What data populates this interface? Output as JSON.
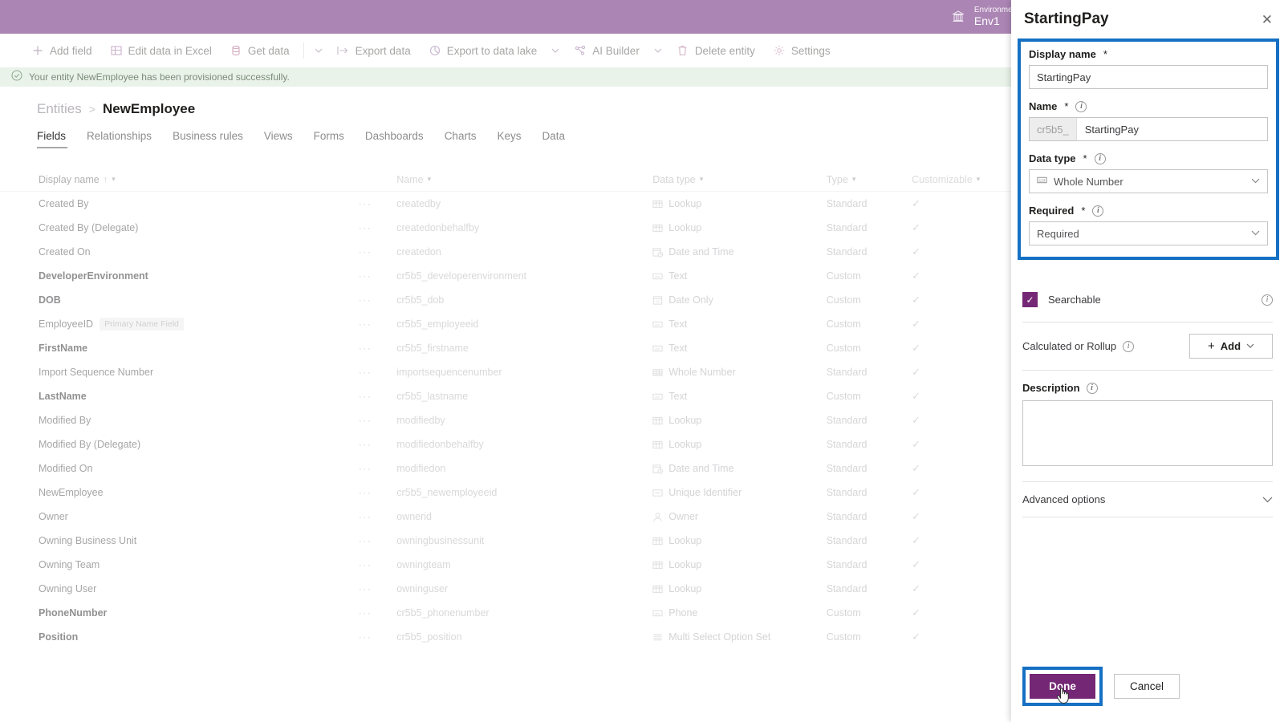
{
  "topbar": {
    "env_label": "Environment",
    "env_value": "Env1",
    "env_icon": "environment-icon"
  },
  "commandbar": {
    "items": [
      {
        "label": "Add field",
        "icon": "plus-icon"
      },
      {
        "label": "Edit data in Excel",
        "icon": "excel-icon"
      },
      {
        "label": "Get data",
        "icon": "database-icon"
      },
      {
        "label": "Export data",
        "icon": "export-icon"
      },
      {
        "label": "Export to data lake",
        "icon": "data-lake-icon"
      },
      {
        "label": "AI Builder",
        "icon": "ai-builder-icon"
      },
      {
        "label": "Delete entity",
        "icon": "trash-icon"
      },
      {
        "label": "Settings",
        "icon": "gear-icon"
      }
    ]
  },
  "notification": {
    "icon": "success-check-icon",
    "message": "Your entity NewEmployee has been provisioned successfully."
  },
  "breadcrumb": {
    "parent": "Entities",
    "separator": ">",
    "current": "NewEmployee"
  },
  "tabs": [
    {
      "label": "Fields",
      "active": true
    },
    {
      "label": "Relationships",
      "active": false
    },
    {
      "label": "Business rules",
      "active": false
    },
    {
      "label": "Views",
      "active": false
    },
    {
      "label": "Forms",
      "active": false
    },
    {
      "label": "Dashboards",
      "active": false
    },
    {
      "label": "Charts",
      "active": false
    },
    {
      "label": "Keys",
      "active": false
    },
    {
      "label": "Data",
      "active": false
    }
  ],
  "table": {
    "columns": [
      {
        "label": "Display name",
        "sorted": "ascending",
        "sort_glyph": "↑"
      },
      {
        "label": "Name"
      },
      {
        "label": "Data type"
      },
      {
        "label": "Type"
      },
      {
        "label": "Customizable"
      }
    ],
    "rows": [
      {
        "display": "Created By",
        "bold": false,
        "badge": "",
        "name": "createdby",
        "datatype": "Lookup",
        "dticon": "lookup-icon",
        "type": "Standard",
        "customizable": "✓"
      },
      {
        "display": "Created By (Delegate)",
        "bold": false,
        "badge": "",
        "name": "createdonbehalfby",
        "datatype": "Lookup",
        "dticon": "lookup-icon",
        "type": "Standard",
        "customizable": "✓"
      },
      {
        "display": "Created On",
        "bold": false,
        "badge": "",
        "name": "createdon",
        "datatype": "Date and Time",
        "dticon": "date-time-icon",
        "type": "Standard",
        "customizable": "✓"
      },
      {
        "display": "DeveloperEnvironment",
        "bold": true,
        "badge": "",
        "name": "cr5b5_developerenvironment",
        "datatype": "Text",
        "dticon": "text-icon",
        "type": "Custom",
        "customizable": "✓"
      },
      {
        "display": "DOB",
        "bold": true,
        "badge": "",
        "name": "cr5b5_dob",
        "datatype": "Date Only",
        "dticon": "date-only-icon",
        "type": "Custom",
        "customizable": "✓"
      },
      {
        "display": "EmployeeID",
        "bold": false,
        "badge": "Primary Name Field",
        "name": "cr5b5_employeeid",
        "datatype": "Text",
        "dticon": "text-icon",
        "type": "Custom",
        "customizable": "✓"
      },
      {
        "display": "FirstName",
        "bold": true,
        "badge": "",
        "name": "cr5b5_firstname",
        "datatype": "Text",
        "dticon": "text-icon",
        "type": "Custom",
        "customizable": "✓"
      },
      {
        "display": "Import Sequence Number",
        "bold": false,
        "badge": "",
        "name": "importsequencenumber",
        "datatype": "Whole Number",
        "dticon": "whole-number-icon",
        "type": "Standard",
        "customizable": "✓"
      },
      {
        "display": "LastName",
        "bold": true,
        "badge": "",
        "name": "cr5b5_lastname",
        "datatype": "Text",
        "dticon": "text-icon",
        "type": "Custom",
        "customizable": "✓"
      },
      {
        "display": "Modified By",
        "bold": false,
        "badge": "",
        "name": "modifiedby",
        "datatype": "Lookup",
        "dticon": "lookup-icon",
        "type": "Standard",
        "customizable": "✓"
      },
      {
        "display": "Modified By (Delegate)",
        "bold": false,
        "badge": "",
        "name": "modifiedonbehalfby",
        "datatype": "Lookup",
        "dticon": "lookup-icon",
        "type": "Standard",
        "customizable": "✓"
      },
      {
        "display": "Modified On",
        "bold": false,
        "badge": "",
        "name": "modifiedon",
        "datatype": "Date and Time",
        "dticon": "date-time-icon",
        "type": "Standard",
        "customizable": "✓"
      },
      {
        "display": "NewEmployee",
        "bold": false,
        "badge": "",
        "name": "cr5b5_newemployeeid",
        "datatype": "Unique Identifier",
        "dticon": "unique-identifier-icon",
        "type": "Standard",
        "customizable": "✓"
      },
      {
        "display": "Owner",
        "bold": false,
        "badge": "",
        "name": "ownerid",
        "datatype": "Owner",
        "dticon": "owner-icon",
        "type": "Standard",
        "customizable": "✓"
      },
      {
        "display": "Owning Business Unit",
        "bold": false,
        "badge": "",
        "name": "owningbusinessunit",
        "datatype": "Lookup",
        "dticon": "lookup-icon",
        "type": "Standard",
        "customizable": "✓"
      },
      {
        "display": "Owning Team",
        "bold": false,
        "badge": "",
        "name": "owningteam",
        "datatype": "Lookup",
        "dticon": "lookup-icon",
        "type": "Standard",
        "customizable": "✓"
      },
      {
        "display": "Owning User",
        "bold": false,
        "badge": "",
        "name": "owninguser",
        "datatype": "Lookup",
        "dticon": "lookup-icon",
        "type": "Standard",
        "customizable": "✓"
      },
      {
        "display": "PhoneNumber",
        "bold": true,
        "badge": "",
        "name": "cr5b5_phonenumber",
        "datatype": "Phone",
        "dticon": "phone-icon",
        "type": "Custom",
        "customizable": "✓"
      },
      {
        "display": "Position",
        "bold": true,
        "badge": "",
        "name": "cr5b5_position",
        "datatype": "Multi Select Option Set",
        "dticon": "multi-select-icon",
        "type": "Custom",
        "customizable": "✓"
      }
    ],
    "row_menu_glyph": "···"
  },
  "panel": {
    "title": "StartingPay",
    "close_glyph": "✕",
    "display_name": {
      "label": "Display name",
      "required_mark": "*",
      "value": "StartingPay"
    },
    "name": {
      "label": "Name",
      "required_mark": "*",
      "prefix": "cr5b5_",
      "value": "StartingPay"
    },
    "data_type": {
      "label": "Data type",
      "required_mark": "*",
      "value": "Whole Number",
      "icon": "whole-number-icon"
    },
    "required": {
      "label": "Required",
      "required_mark": "*",
      "value": "Required"
    },
    "searchable": {
      "label": "Searchable",
      "checked": true,
      "check_glyph": "✓"
    },
    "calculated": {
      "label": "Calculated or Rollup",
      "button_label": "Add",
      "plus_glyph": "+"
    },
    "description": {
      "label": "Description",
      "value": "",
      "placeholder": ""
    },
    "advanced_options": {
      "label": "Advanced options"
    },
    "footer": {
      "done_label": "Done",
      "cancel_label": "Cancel"
    },
    "highlight_color": "#1570c4",
    "accent_color": "#742774"
  }
}
